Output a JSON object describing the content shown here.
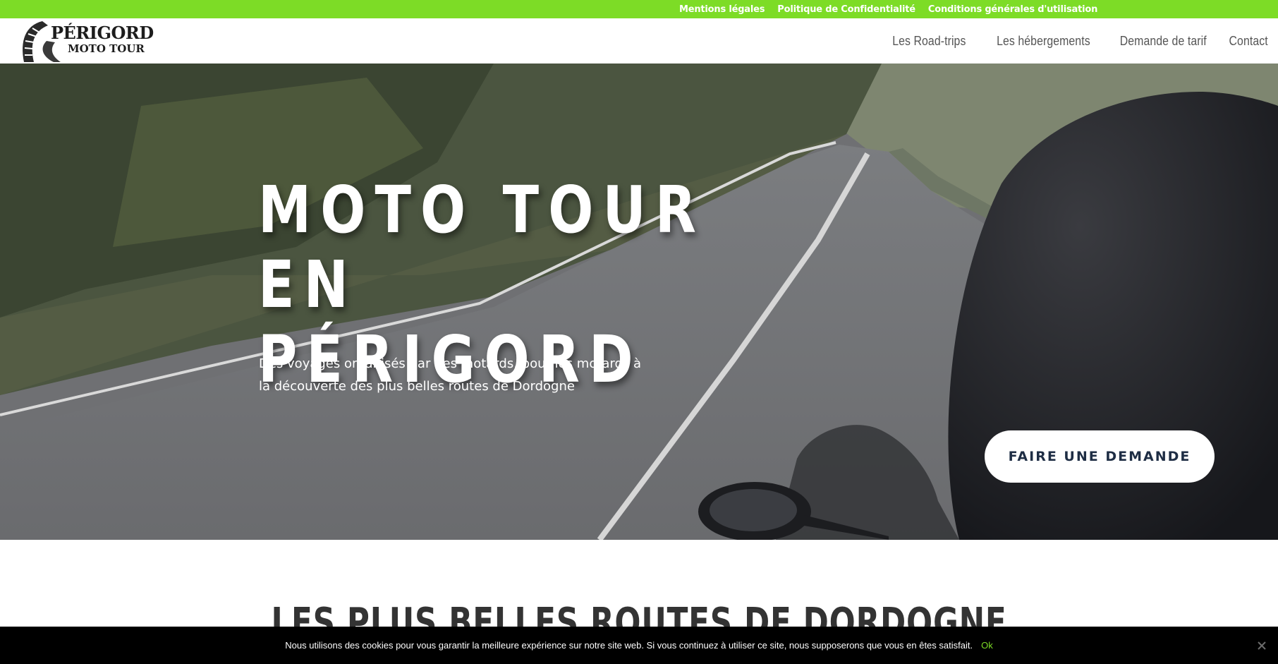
{
  "topbar": {
    "links": [
      "Mentions légales",
      "Politique de Confidentialité",
      "Conditions générales d'utilisation"
    ],
    "color": "#7ddc26"
  },
  "header": {
    "logo": {
      "line1": "PÉRIGORD",
      "line2": "MOTO TOUR",
      "icon": "tire-track-icon"
    },
    "nav": [
      "Les Road-trips",
      "Les hébergements",
      "Demande de tarif",
      "Contact"
    ]
  },
  "hero": {
    "title_line1": "MOTO TOUR EN",
    "title_line2": "PÉRIGORD",
    "subtitle": "Des voyages organisés par des motards, pour les motards à la découverte des plus belles routes de Dordogne",
    "cta": "FAIRE UNE DEMANDE",
    "background": "road-with-motorcycle-helmet-photo"
  },
  "section": {
    "title": "LES PLUS BELLES ROUTES DE DORDOGNE"
  },
  "cookie": {
    "text": "Nous utilisons des cookies pour vous garantir la meilleure expérience sur notre site web. Si vous continuez à utiliser ce site, nous supposerons que vous en êtes satisfait.",
    "ok": "Ok",
    "close_icon": "close-icon"
  },
  "colors": {
    "accent": "#7ddc26",
    "cta_text": "#1e2d44",
    "nav_text": "#555555"
  }
}
